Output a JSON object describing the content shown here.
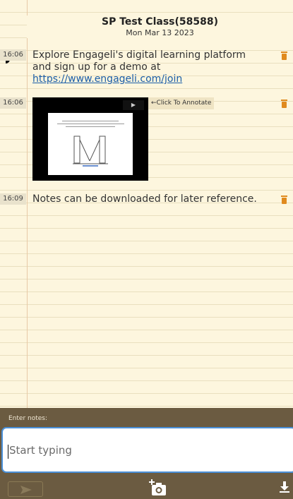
{
  "header": {
    "class_title": "SP Test Class(58588)",
    "class_date": "Mon Mar 13 2023"
  },
  "notes": [
    {
      "time": "16:06",
      "text": "Explore Engageli's digital learning platform and sign up for a demo at",
      "link": "https://www.engageli.com/join"
    },
    {
      "time": "16:06",
      "image_annotation_label": "←Click To Annotate",
      "thumbnail_play_glyph": "▶"
    },
    {
      "time": "16:09",
      "text": "Notes can be downloaded for later reference."
    }
  ],
  "composer": {
    "label": "Enter notes:",
    "placeholder": "Start typing",
    "value": ""
  },
  "icons": {
    "delete": "trash-icon",
    "send": "send-icon",
    "camera": "add-photo-icon",
    "download": "download-icon"
  },
  "colors": {
    "paper": "#fdf6de",
    "rule_line": "#e9dfbf",
    "margin_line": "#e8c9a6",
    "trash": "#e08a1e",
    "link": "#1b5ea8",
    "composer_bg": "#6b5b41",
    "input_border": "#4a90d9"
  }
}
